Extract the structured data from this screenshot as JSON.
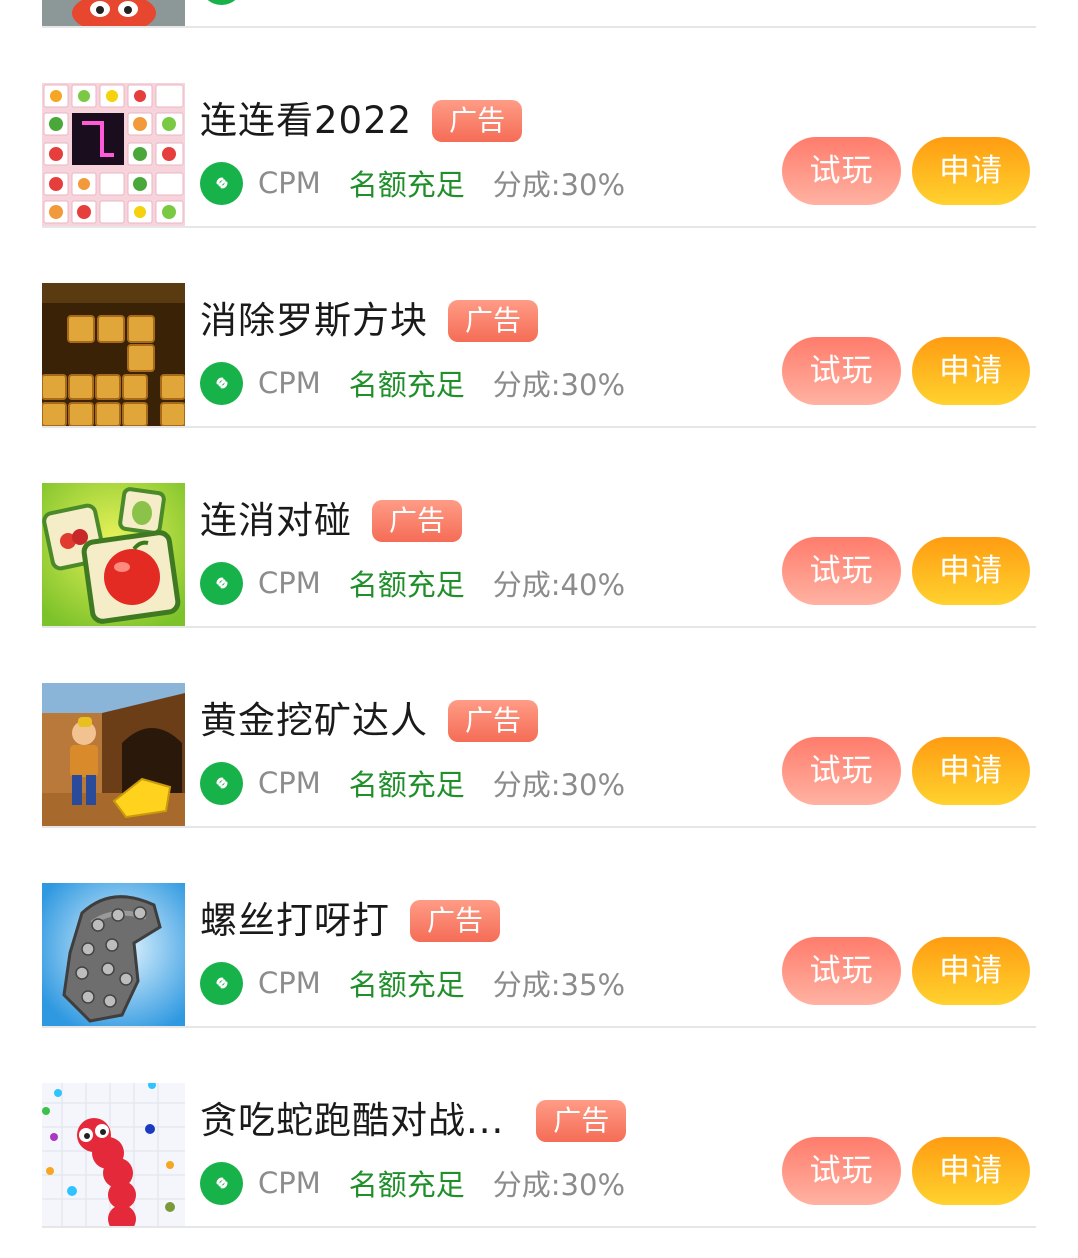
{
  "items": [
    {
      "title": "",
      "badge": "",
      "type": "",
      "quota": "",
      "share": "",
      "try_label": "",
      "apply_label": ""
    },
    {
      "title": "连连看2022",
      "badge": "广告",
      "type": "CPM",
      "quota": "名额充足",
      "share": "分成:30%",
      "try_label": "试玩",
      "apply_label": "申请"
    },
    {
      "title": "消除罗斯方块",
      "badge": "广告",
      "type": "CPM",
      "quota": "名额充足",
      "share": "分成:30%",
      "try_label": "试玩",
      "apply_label": "申请"
    },
    {
      "title": "连消对碰",
      "badge": "广告",
      "type": "CPM",
      "quota": "名额充足",
      "share": "分成:40%",
      "try_label": "试玩",
      "apply_label": "申请"
    },
    {
      "title": "黄金挖矿达人",
      "badge": "广告",
      "type": "CPM",
      "quota": "名额充足",
      "share": "分成:30%",
      "try_label": "试玩",
      "apply_label": "申请"
    },
    {
      "title": "螺丝打呀打",
      "badge": "广告",
      "type": "CPM",
      "quota": "名额充足",
      "share": "分成:35%",
      "try_label": "试玩",
      "apply_label": "申请"
    },
    {
      "title": "贪吃蛇跑酷对战...",
      "badge": "广告",
      "type": "CPM",
      "quota": "名额充足",
      "share": "分成:30%",
      "try_label": "试玩",
      "apply_label": "申请"
    }
  ],
  "colors": {
    "ad_badge": "#f56c56",
    "try_button": "#ff8a7a",
    "apply_button": "#ffb21e",
    "quota_text": "#1f8f2a",
    "link_icon_bg": "#17b24a"
  },
  "icons": {
    "link": "mini-program-link-icon"
  }
}
